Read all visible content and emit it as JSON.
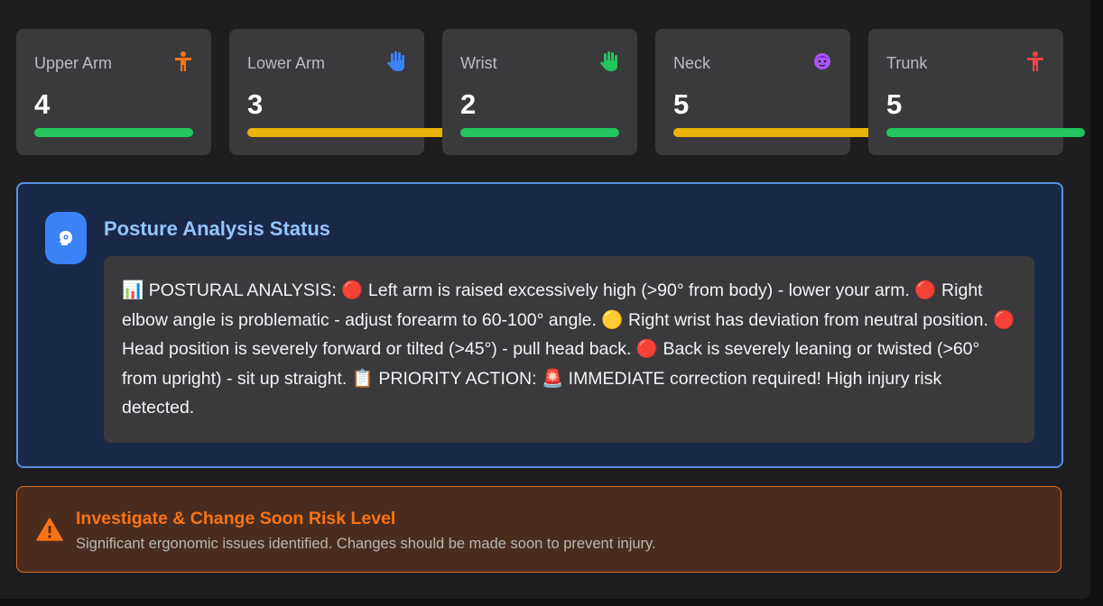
{
  "cards": [
    {
      "title": "Upper Arm",
      "score": "4",
      "icon": "person-icon",
      "icon_color": "#f97316",
      "bar_color": "#22c55e",
      "bar_fill": 1.0
    },
    {
      "title": "Lower Arm",
      "score": "3",
      "icon": "hand-icon",
      "icon_color": "#3b82f6",
      "bar_color": "#eab308",
      "bar_fill": 1.0
    },
    {
      "title": "Wrist",
      "score": "2",
      "icon": "hand-icon",
      "icon_color": "#22c55e",
      "bar_color": "#22c55e",
      "bar_fill": 1.0
    },
    {
      "title": "Neck",
      "score": "5",
      "icon": "face-icon",
      "icon_color": "#a855f7",
      "bar_color": "#eab308",
      "bar_fill": 1.0
    },
    {
      "title": "Trunk",
      "score": "5",
      "icon": "person-icon",
      "icon_color": "#ef4444",
      "bar_color": "#22c55e",
      "bar_fill": 1.0
    }
  ],
  "status": {
    "title": "Posture Analysis Status",
    "icon": "brain-gear-icon",
    "text": "📊 POSTURAL ANALYSIS: 🔴 Left arm is raised excessively high (>90° from body) - lower your arm. 🔴 Right elbow angle is problematic - adjust forearm to 60-100° angle. 🟡 Right wrist has deviation from neutral position. 🔴 Head position is severely forward or tilted (>45°) - pull head back. 🔴 Back is severely leaning or twisted (>60° from upright) - sit up straight. 📋 PRIORITY ACTION: 🚨 IMMEDIATE correction required! High injury risk detected."
  },
  "risk": {
    "title": "Investigate & Change Soon Risk Level",
    "description": "Significant ergonomic issues identified. Changes should be made soon to prevent injury.",
    "icon": "warning-triangle-icon",
    "accent": "#f97316"
  }
}
